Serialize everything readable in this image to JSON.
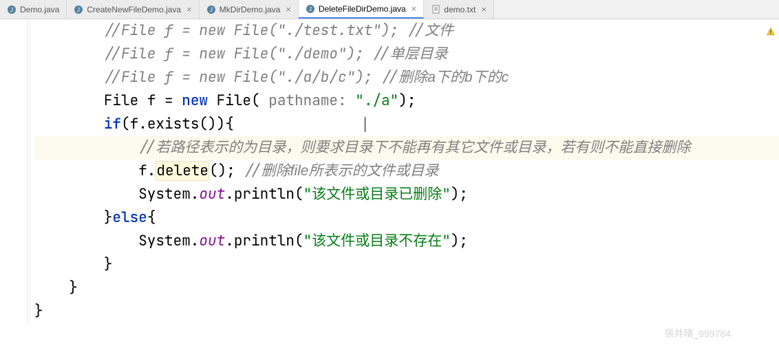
{
  "tabs": {
    "items": [
      {
        "label": "Demo.java"
      },
      {
        "label": "CreateNewFileDemo.java"
      },
      {
        "label": "MkDirDemo.java"
      },
      {
        "label": "DeleteFileDirDemo.java"
      },
      {
        "label": "demo.txt"
      }
    ],
    "activeIndex": 3
  },
  "code": {
    "l1_comment": "//File f = new File(\"./test.txt\"); //",
    "l1_cjk": "文件",
    "l2_comment": "//File f = new File(\"./demo\"); //",
    "l2_cjk": "单层目录",
    "l3_comment": "//File f = new File(\"./a/b/c\"); //",
    "l3_cjk": "删除a下的b下的c",
    "l4_type": "File",
    "l4_var": " f = ",
    "l4_new": "new",
    "l4_ctor": " File( ",
    "l4_hint": "pathname:",
    "l4_str": "\"./a\"",
    "l4_end": ");",
    "l5_if": "if",
    "l5_cond": "(f.exists()){",
    "l6_comment_pre": "//",
    "l6_cjk": "若路径表示的为目录，则要求目录下不能再有其它文件或目录，若有则不能直接删除",
    "l7_obj": "f.",
    "l7_method": "delete",
    "l7_after": "(); ",
    "l7_comment_pre": "//",
    "l7_cjk_a": "删除file",
    "l7_cjk_b": "所表示的文件或目录",
    "l8_sys": "System.",
    "l8_out": "out",
    "l8_print": ".println(",
    "l8_str": "\"该文件或目录已删除\"",
    "l8_end": ");",
    "l9_brace": "}",
    "l9_else": "else",
    "l9_open": "{",
    "l10_sys": "System.",
    "l10_out": "out",
    "l10_print": ".println(",
    "l10_str": "\"该文件或目录不存在\"",
    "l10_end": ");",
    "l11_brace": "}",
    "l12_brace": "}",
    "l13_brace": "}"
  },
  "watermark": "張井晴_999784"
}
